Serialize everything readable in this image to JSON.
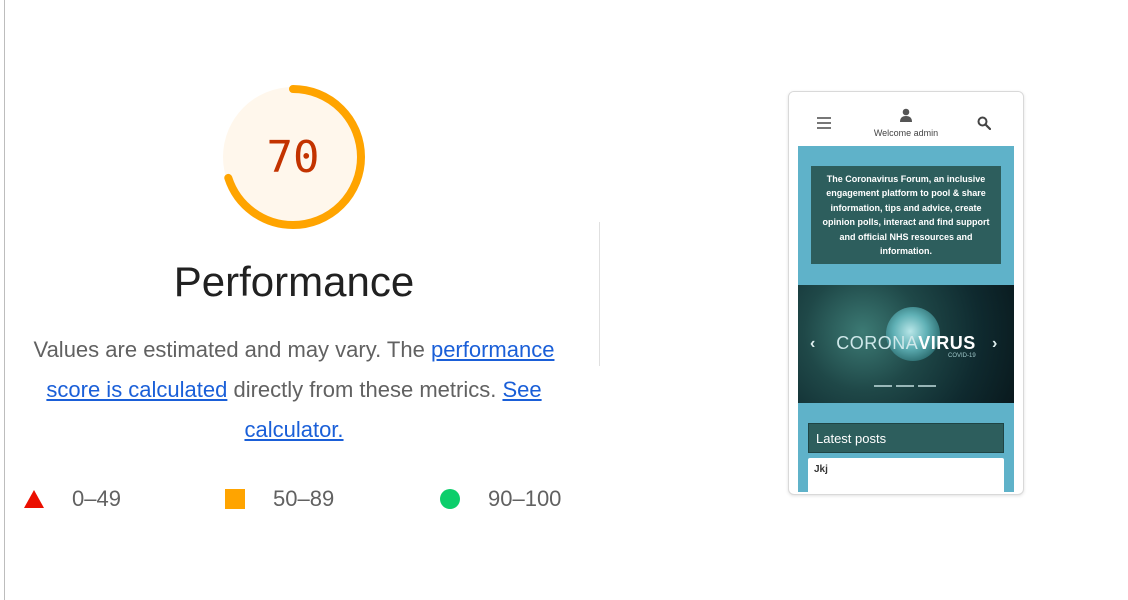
{
  "gauge": {
    "score": "70",
    "score_value": 70,
    "label": "Performance",
    "ring_color": "#ffa400",
    "text_color": "#c33300",
    "fill_color": "#fff7ec"
  },
  "description": {
    "text_1": "Values are estimated and may vary. The ",
    "link_1": "performance score is calculated",
    "text_2": " directly from these metrics. ",
    "link_2": "See calculator."
  },
  "legend": [
    {
      "shape": "triangle-icon",
      "range": "0–49",
      "color": "#eb0f00"
    },
    {
      "shape": "square-icon",
      "range": "50–89",
      "color": "#ffa400"
    },
    {
      "shape": "circle-icon",
      "range": "90–100",
      "color": "#0cce6b"
    }
  ],
  "screenshot": {
    "welcome": "Welcome admin",
    "intro": "The Coronavirus Forum, an inclusive engagement platform to pool & share information, tips and advice, create opinion polls, interact and find support and official NHS resources and information.",
    "banner_light": "CORONA",
    "banner_bold": "VIRUS",
    "banner_sub": "COVID-19",
    "posts_header": "Latest posts",
    "post_title": "Jkj"
  }
}
